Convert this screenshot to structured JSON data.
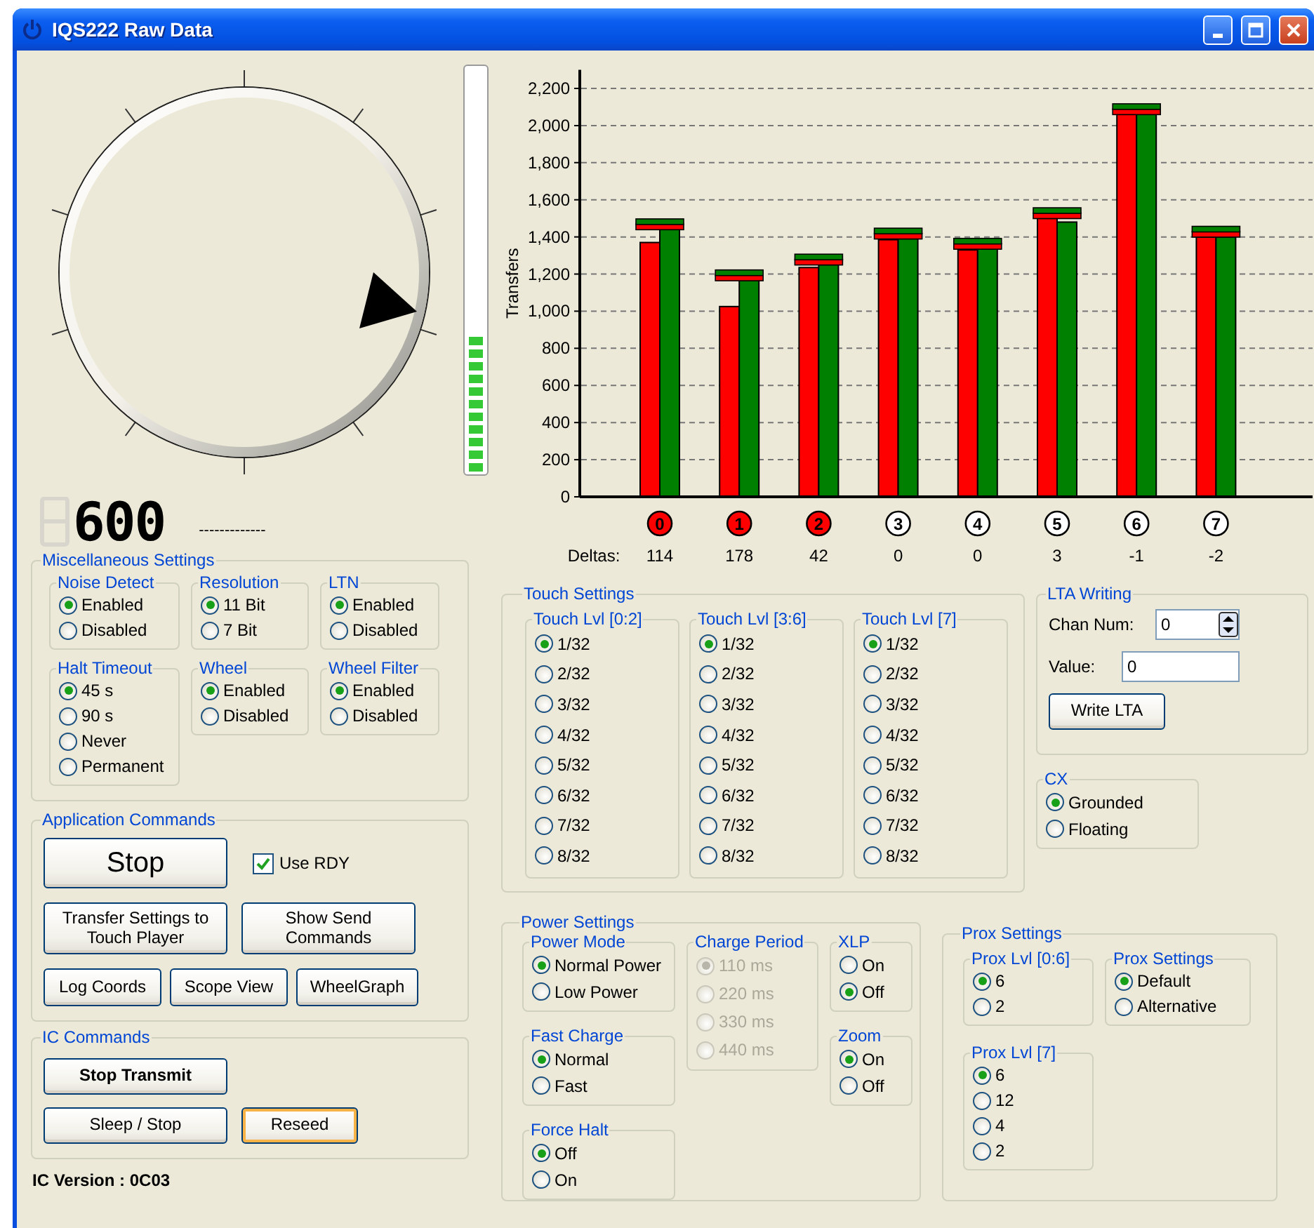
{
  "window": {
    "title": "IQS222 Raw Data"
  },
  "level_meter": {
    "level": 0.34
  },
  "counter": {
    "value": "600",
    "dashes": "-------------"
  },
  "misc_settings": {
    "title": "Miscellaneous Settings",
    "groups": [
      {
        "title": "Noise Detect",
        "disabled": false,
        "options": [
          {
            "label": "Enabled",
            "selected": true
          },
          {
            "label": "Disabled",
            "selected": false
          }
        ]
      },
      {
        "title": "Resolution",
        "disabled": false,
        "options": [
          {
            "label": "11 Bit",
            "selected": true
          },
          {
            "label": "7 Bit",
            "selected": false
          }
        ]
      },
      {
        "title": "LTN",
        "disabled": false,
        "options": [
          {
            "label": "Enabled",
            "selected": true
          },
          {
            "label": "Disabled",
            "selected": false
          }
        ]
      },
      {
        "title": "Halt Timeout",
        "disabled": false,
        "options": [
          {
            "label": "45 s",
            "selected": true
          },
          {
            "label": "90 s",
            "selected": false
          },
          {
            "label": "Never",
            "selected": false
          },
          {
            "label": "Permanent",
            "selected": false
          }
        ]
      },
      {
        "title": "Wheel",
        "disabled": false,
        "options": [
          {
            "label": "Enabled",
            "selected": true
          },
          {
            "label": "Disabled",
            "selected": false
          }
        ]
      },
      {
        "title": "Wheel Filter",
        "disabled": false,
        "options": [
          {
            "label": "Enabled",
            "selected": true
          },
          {
            "label": "Disabled",
            "selected": false
          }
        ]
      }
    ]
  },
  "application_commands": {
    "title": "Application Commands",
    "stop_button": "Stop",
    "use_rdy": {
      "label": "Use RDY",
      "checked": true
    },
    "button_rows": [
      [
        {
          "label": "Transfer Settings to Touch Player"
        },
        {
          "label": "Show Send Commands"
        }
      ],
      [
        {
          "label": "Log Coords"
        },
        {
          "label": "Scope View"
        },
        {
          "label": "WheelGraph"
        }
      ]
    ]
  },
  "ic_commands": {
    "title": "IC Commands",
    "button_rows": [
      [
        {
          "label": "Stop Transmit",
          "kind": "bold",
          "focused": false
        }
      ],
      [
        {
          "label": "Sleep / Stop",
          "kind": "normal",
          "focused": false
        },
        {
          "label": "Reseed",
          "kind": "normal",
          "focused": true
        }
      ]
    ]
  },
  "ic_version": "IC Version : 0C03",
  "chart": {
    "chart_data": {
      "type": "bar",
      "ylabel": "Transfers",
      "categories": [
        "0",
        "1",
        "2",
        "3",
        "4",
        "5",
        "6",
        "7"
      ],
      "series": [
        {
          "color": "#ff0000",
          "values": [
            1370,
            1025,
            1235,
            1385,
            1330,
            1500,
            2060,
            1400
          ]
        },
        {
          "color": "#008000",
          "values": [
            1440,
            1165,
            1250,
            1390,
            1335,
            1480,
            2060,
            1400
          ]
        }
      ],
      "ylim": [
        0,
        2300
      ],
      "grid": true,
      "yticks": [
        {
          "value": 0,
          "label": "0"
        },
        {
          "value": 200,
          "label": "200"
        },
        {
          "value": 400,
          "label": "400"
        },
        {
          "value": 600,
          "label": "600"
        },
        {
          "value": 800,
          "label": "800"
        },
        {
          "value": 1000,
          "label": "1,000"
        },
        {
          "value": 1200,
          "label": "1,200"
        },
        {
          "value": 1400,
          "label": "1,400"
        },
        {
          "value": 1600,
          "label": "1,600"
        },
        {
          "value": 1800,
          "label": "1,800"
        },
        {
          "value": 2000,
          "label": "2,000"
        },
        {
          "value": 2200,
          "label": "2,200"
        }
      ]
    },
    "deltas_label": "Deltas:",
    "channels": [
      {
        "touched": true,
        "delta": "114"
      },
      {
        "touched": true,
        "delta": "178"
      },
      {
        "touched": true,
        "delta": "42"
      },
      {
        "touched": false,
        "delta": "0"
      },
      {
        "touched": false,
        "delta": "0"
      },
      {
        "touched": false,
        "delta": "3"
      },
      {
        "touched": false,
        "delta": "-1"
      },
      {
        "touched": false,
        "delta": "-2"
      }
    ]
  },
  "touch_settings": {
    "title": "Touch Settings",
    "groups": [
      {
        "title": "Touch Lvl [0:2]",
        "disabled": false,
        "options": [
          {
            "label": "1/32",
            "selected": true
          },
          {
            "label": "2/32",
            "selected": false
          },
          {
            "label": "3/32",
            "selected": false
          },
          {
            "label": "4/32",
            "selected": false
          },
          {
            "label": "5/32",
            "selected": false
          },
          {
            "label": "6/32",
            "selected": false
          },
          {
            "label": "7/32",
            "selected": false
          },
          {
            "label": "8/32",
            "selected": false
          }
        ]
      },
      {
        "title": "Touch Lvl [3:6]",
        "disabled": false,
        "options": [
          {
            "label": "1/32",
            "selected": true
          },
          {
            "label": "2/32",
            "selected": false
          },
          {
            "label": "3/32",
            "selected": false
          },
          {
            "label": "4/32",
            "selected": false
          },
          {
            "label": "5/32",
            "selected": false
          },
          {
            "label": "6/32",
            "selected": false
          },
          {
            "label": "7/32",
            "selected": false
          },
          {
            "label": "8/32",
            "selected": false
          }
        ]
      },
      {
        "title": "Touch Lvl [7]",
        "disabled": false,
        "options": [
          {
            "label": "1/32",
            "selected": true
          },
          {
            "label": "2/32",
            "selected": false
          },
          {
            "label": "3/32",
            "selected": false
          },
          {
            "label": "4/32",
            "selected": false
          },
          {
            "label": "5/32",
            "selected": false
          },
          {
            "label": "6/32",
            "selected": false
          },
          {
            "label": "7/32",
            "selected": false
          },
          {
            "label": "8/32",
            "selected": false
          }
        ]
      }
    ]
  },
  "lta_writing": {
    "title": "LTA Writing",
    "chan_num": {
      "label": "Chan Num:",
      "value": "0"
    },
    "value": {
      "label": "Value:",
      "value": "0"
    },
    "button": "Write LTA"
  },
  "cx": {
    "title": "CX",
    "disabled": false,
    "options": [
      {
        "label": "Grounded",
        "selected": true
      },
      {
        "label": "Floating",
        "selected": false
      }
    ]
  },
  "power_settings": {
    "title": "Power Settings",
    "columns": [
      [
        {
          "title": "Power Mode",
          "disabled": false,
          "options": [
            {
              "label": "Normal Power",
              "selected": true
            },
            {
              "label": "Low Power",
              "selected": false
            }
          ]
        },
        {
          "title": "Fast Charge",
          "disabled": false,
          "options": [
            {
              "label": "Normal",
              "selected": true
            },
            {
              "label": "Fast",
              "selected": false
            }
          ]
        },
        {
          "title": "Force Halt",
          "disabled": false,
          "options": [
            {
              "label": "Off",
              "selected": true
            },
            {
              "label": "On",
              "selected": false
            }
          ]
        }
      ],
      [
        {
          "title": "Charge Period",
          "disabled": true,
          "options": [
            {
              "label": "110 ms",
              "selected": true
            },
            {
              "label": "220 ms",
              "selected": false
            },
            {
              "label": "330 ms",
              "selected": false
            },
            {
              "label": "440 ms",
              "selected": false
            }
          ]
        }
      ],
      [
        {
          "title": "XLP",
          "disabled": false,
          "options": [
            {
              "label": "On",
              "selected": false
            },
            {
              "label": "Off",
              "selected": true
            }
          ]
        },
        {
          "title": "Zoom",
          "disabled": false,
          "options": [
            {
              "label": "On",
              "selected": true
            },
            {
              "label": "Off",
              "selected": false
            }
          ]
        }
      ]
    ]
  },
  "prox_settings": {
    "title": "Prox Settings",
    "columns": [
      [
        {
          "title": "Prox Lvl [0:6]",
          "disabled": false,
          "options": [
            {
              "label": "6",
              "selected": true
            },
            {
              "label": "2",
              "selected": false
            }
          ]
        },
        {
          "title": "Prox Lvl [7]",
          "disabled": false,
          "options": [
            {
              "label": "6",
              "selected": true
            },
            {
              "label": "12",
              "selected": false
            },
            {
              "label": "4",
              "selected": false
            },
            {
              "label": "2",
              "selected": false
            }
          ]
        }
      ],
      [
        {
          "title": "Prox Settings",
          "disabled": false,
          "options": [
            {
              "label": "Default",
              "selected": true
            },
            {
              "label": "Alternative",
              "selected": false
            }
          ]
        }
      ]
    ]
  }
}
